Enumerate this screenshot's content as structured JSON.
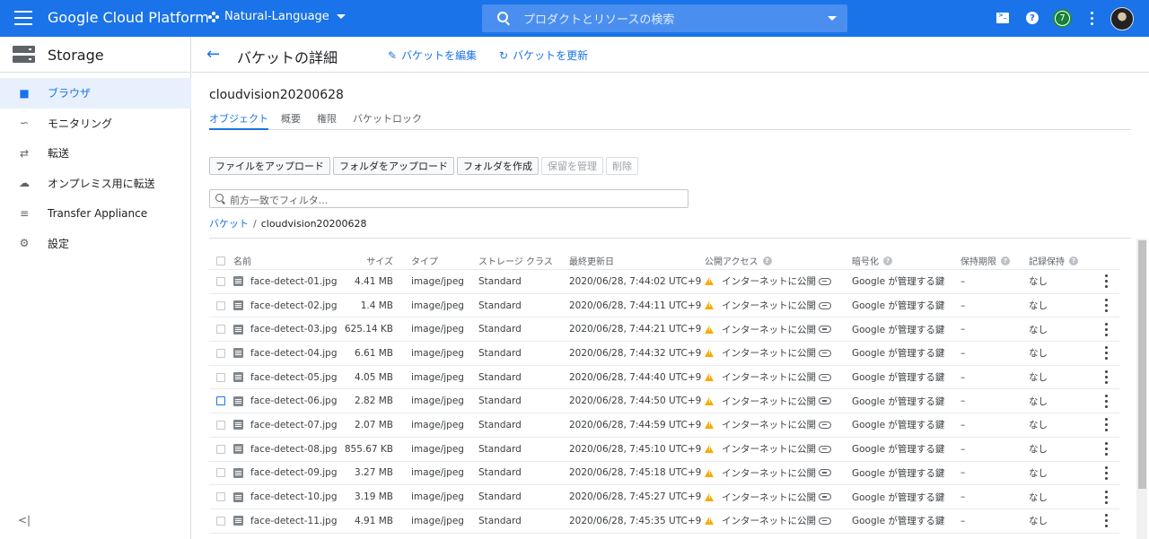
{
  "topbar": {
    "brand": "Google Cloud Platform",
    "project": "Natural-Language",
    "search_placeholder": "プロダクトとリソースの検索",
    "notification_count": "7"
  },
  "sidebar": {
    "title": "Storage",
    "items": [
      {
        "label": "ブラウザ",
        "icon": "bucket-icon",
        "active": true
      },
      {
        "label": "モニタリング",
        "icon": "chart-icon",
        "active": false
      },
      {
        "label": "転送",
        "icon": "transfer-icon",
        "active": false
      },
      {
        "label": "オンプレミス用に転送",
        "icon": "cloud-upload-icon",
        "active": false
      },
      {
        "label": "Transfer Appliance",
        "icon": "appliance-icon",
        "active": false
      },
      {
        "label": "設定",
        "icon": "gear-icon",
        "active": false
      }
    ],
    "collapse_label": "<|"
  },
  "header": {
    "title": "バケットの詳細",
    "edit_label": "バケットを編集",
    "refresh_label": "バケットを更新"
  },
  "bucket": {
    "name": "cloudvision20200628",
    "tabs": [
      "オブジェクト",
      "概要",
      "権限",
      "バケットロック"
    ],
    "active_tab": "オブジェクト",
    "actions": [
      {
        "label": "ファイルをアップロード",
        "enabled": true
      },
      {
        "label": "フォルダをアップロード",
        "enabled": true
      },
      {
        "label": "フォルダを作成",
        "enabled": true
      },
      {
        "label": "保留を管理",
        "enabled": false
      },
      {
        "label": "削除",
        "enabled": false
      }
    ],
    "filter_placeholder": "前方一致でフィルタ...",
    "breadcrumb_root": "バケット",
    "breadcrumb_sep": "/",
    "breadcrumb_current": "cloudvision20200628"
  },
  "table": {
    "headers": {
      "name": "名前",
      "size": "サイズ",
      "type": "タイプ",
      "storage_class": "ストレージ クラス",
      "updated": "最終更新日",
      "public": "公開アクセス",
      "encryption": "暗号化",
      "retention": "保持期限",
      "hold": "記録保持"
    },
    "rows": [
      {
        "name": "face-detect-01.jpg",
        "size": "4.41 MB",
        "type": "image/jpeg",
        "storage_class": "Standard",
        "updated": "2020/06/28, 7:44:02 UTC+9",
        "public": "インターネットに公開",
        "encryption": "Google が管理する鍵",
        "retention": "–",
        "hold": "なし"
      },
      {
        "name": "face-detect-02.jpg",
        "size": "1.4 MB",
        "type": "image/jpeg",
        "storage_class": "Standard",
        "updated": "2020/06/28, 7:44:11 UTC+9",
        "public": "インターネットに公開",
        "encryption": "Google が管理する鍵",
        "retention": "–",
        "hold": "なし"
      },
      {
        "name": "face-detect-03.jpg",
        "size": "625.14 KB",
        "type": "image/jpeg",
        "storage_class": "Standard",
        "updated": "2020/06/28, 7:44:21 UTC+9",
        "public": "インターネットに公開",
        "encryption": "Google が管理する鍵",
        "retention": "–",
        "hold": "なし"
      },
      {
        "name": "face-detect-04.jpg",
        "size": "6.61 MB",
        "type": "image/jpeg",
        "storage_class": "Standard",
        "updated": "2020/06/28, 7:44:32 UTC+9",
        "public": "インターネットに公開",
        "encryption": "Google が管理する鍵",
        "retention": "–",
        "hold": "なし"
      },
      {
        "name": "face-detect-05.jpg",
        "size": "4.05 MB",
        "type": "image/jpeg",
        "storage_class": "Standard",
        "updated": "2020/06/28, 7:44:40 UTC+9",
        "public": "インターネットに公開",
        "encryption": "Google が管理する鍵",
        "retention": "–",
        "hold": "なし"
      },
      {
        "name": "face-detect-06.jpg",
        "size": "2.82 MB",
        "type": "image/jpeg",
        "storage_class": "Standard",
        "updated": "2020/06/28, 7:44:50 UTC+9",
        "public": "インターネットに公開",
        "encryption": "Google が管理する鍵",
        "retention": "–",
        "hold": "なし"
      },
      {
        "name": "face-detect-07.jpg",
        "size": "2.07 MB",
        "type": "image/jpeg",
        "storage_class": "Standard",
        "updated": "2020/06/28, 7:44:59 UTC+9",
        "public": "インターネットに公開",
        "encryption": "Google が管理する鍵",
        "retention": "–",
        "hold": "なし"
      },
      {
        "name": "face-detect-08.jpg",
        "size": "855.67 KB",
        "type": "image/jpeg",
        "storage_class": "Standard",
        "updated": "2020/06/28, 7:45:10 UTC+9",
        "public": "インターネットに公開",
        "encryption": "Google が管理する鍵",
        "retention": "–",
        "hold": "なし"
      },
      {
        "name": "face-detect-09.jpg",
        "size": "3.27 MB",
        "type": "image/jpeg",
        "storage_class": "Standard",
        "updated": "2020/06/28, 7:45:18 UTC+9",
        "public": "インターネットに公開",
        "encryption": "Google が管理する鍵",
        "retention": "–",
        "hold": "なし"
      },
      {
        "name": "face-detect-10.jpg",
        "size": "3.19 MB",
        "type": "image/jpeg",
        "storage_class": "Standard",
        "updated": "2020/06/28, 7:45:27 UTC+9",
        "public": "インターネットに公開",
        "encryption": "Google が管理する鍵",
        "retention": "–",
        "hold": "なし"
      },
      {
        "name": "face-detect-11.jpg",
        "size": "4.91 MB",
        "type": "image/jpeg",
        "storage_class": "Standard",
        "updated": "2020/06/28, 7:45:35 UTC+9",
        "public": "インターネットに公開",
        "encryption": "Google が管理する鍵",
        "retention": "–",
        "hold": "なし"
      }
    ]
  },
  "colors": {
    "brand": "#1a73e8",
    "warning": "#f9ab00",
    "active_nav_bg": "#e8f0fe"
  }
}
